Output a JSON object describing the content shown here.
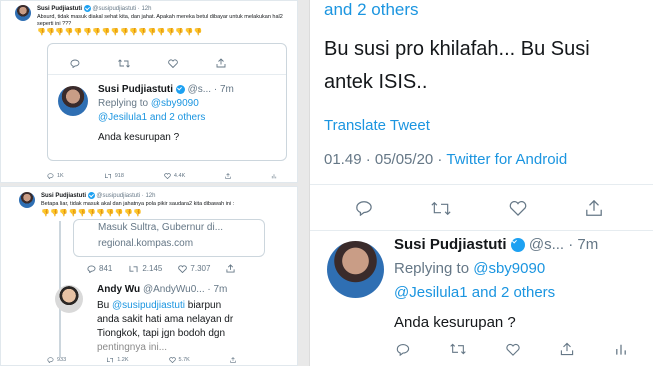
{
  "left_top": {
    "author_name": "Susi Pudjiastuti",
    "author_handle_time": "@susipudjiastuti · 12h",
    "text": "Absurd, tidak masuk diakal sehat kita, dan jahat. Apakah mereka betul dibayar untuk melakukan hal2 seperti ini ???",
    "emoji": "👎👎👎👎👎👎👎👎👎👎👎👎👎👎👎👎👎👎",
    "reply": {
      "author_name": "Susi Pudjiastuti",
      "handle_time": "@s... · 7m",
      "replying_prefix": "Replying to",
      "replying_handle": "@sby9090",
      "replying_others": "@Jesilula1 and 2 others",
      "text": "Anda kesurupan ?"
    },
    "stats": {
      "replies": "1K",
      "retweets": "918",
      "likes": "4.4K"
    }
  },
  "left_bottom": {
    "author_name": "Susi Pudjiastuti",
    "author_handle_time": "@susipudjiastuti · 12h",
    "text": "Betapa liar, tidak masuk akal dan jahatnya pola pikir saudara2 kita dibawah ini :",
    "emoji": "👎👎👎👎👎👎👎👎👎👎👎",
    "card_text1": "Masuk Sultra, Gubernur di...",
    "card_url": "regional.kompas.com",
    "card_stats": {
      "replies": "841",
      "retweets": "2.145",
      "likes": "7.307"
    },
    "reply": {
      "author_name": "Andy Wu",
      "handle_time": "@AndyWu0... · 7m",
      "text_mention": "@susipudjiastuti",
      "text_prefix": "Bu",
      "text_rest1": "biarpun",
      "text_line2": "anda sakit hati ama nelayan dr",
      "text_line3": "Tiongkok, tapi jgn bodoh dgn",
      "text_line4": "pentingnya ini..."
    },
    "stats": {
      "replies": "933",
      "retweets": "1.2K",
      "likes": "5.7K"
    }
  },
  "right": {
    "top_link": "and 2 others",
    "tweet_text1": "Bu susi pro khilafah... Bu Susi",
    "tweet_text2": "antek ISIS..",
    "translate": "Translate Tweet",
    "meta_time": "01.49 · 05/05/20 ·",
    "meta_source": "Twitter for Android",
    "reply": {
      "author_name": "Susi Pudjiastuti",
      "handle_time": "@s... · 7m",
      "replying_prefix": "Replying to",
      "replying_handle": "@sby9090",
      "replying_others": "@Jesilula1 and 2 others",
      "text": "Anda kesurupan ?"
    }
  },
  "colors": {
    "link": "#1b95e0",
    "muted": "#657786",
    "verified": "#1da1f2"
  }
}
